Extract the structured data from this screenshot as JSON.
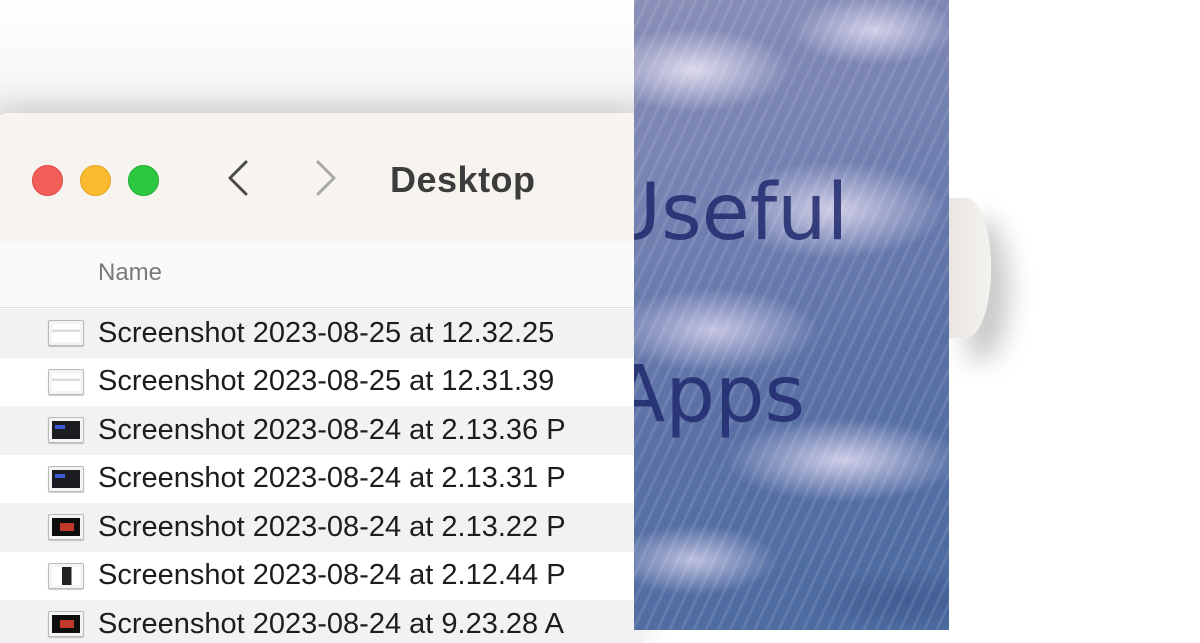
{
  "window": {
    "title": "Desktop",
    "back_label": "‹",
    "forward_label": "›"
  },
  "columns": {
    "name": "Name"
  },
  "files": [
    {
      "name": "Screenshot 2023-08-25 at 12.32.25",
      "thumb": "light"
    },
    {
      "name": "Screenshot 2023-08-25 at 12.31.39",
      "thumb": "light"
    },
    {
      "name": "Screenshot 2023-08-24 at 2.13.36 P",
      "thumb": "dark"
    },
    {
      "name": "Screenshot 2023-08-24 at 2.13.31 P",
      "thumb": "dark"
    },
    {
      "name": "Screenshot 2023-08-24 at 2.13.22 P",
      "thumb": "black"
    },
    {
      "name": "Screenshot 2023-08-24 at 2.12.44 P",
      "thumb": "mixed"
    },
    {
      "name": "Screenshot 2023-08-24 at 9.23.28 A",
      "thumb": "black"
    }
  ],
  "art": {
    "word1": "Useful",
    "word2": "Apps"
  },
  "colors": {
    "close": "#f25e58",
    "minimize": "#fbbb2f",
    "zoom": "#2cc840",
    "titlebar": "#f7f3ee"
  }
}
